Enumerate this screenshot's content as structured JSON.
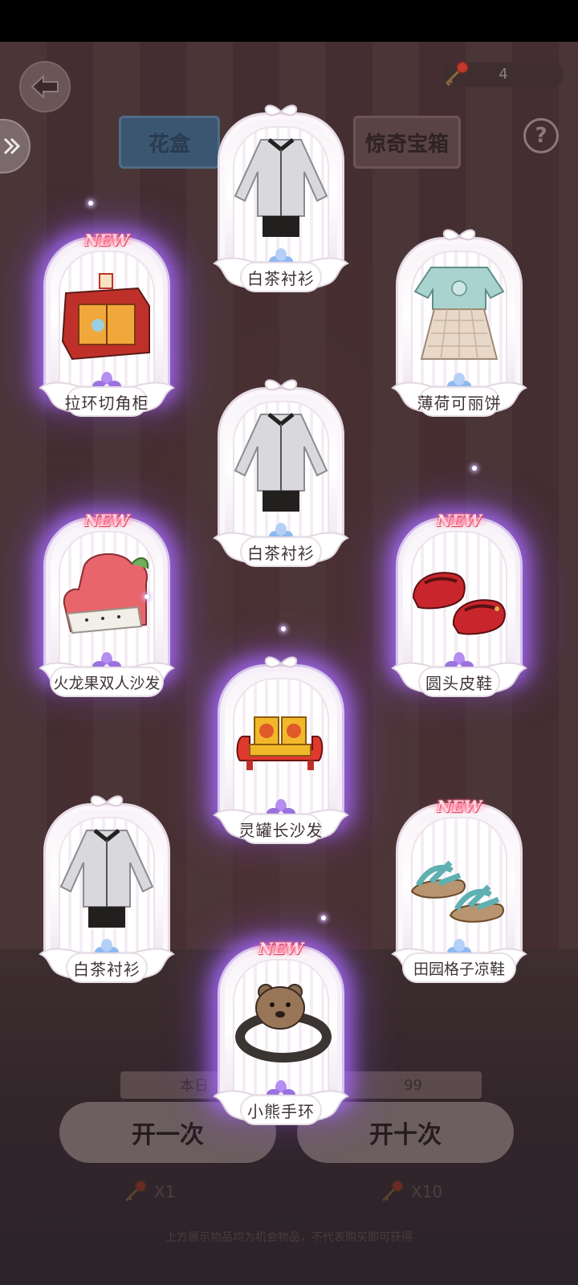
{
  "header": {
    "key_count": "4",
    "tabs": {
      "flower_box": "花盒",
      "surprise_chest": "惊奇宝箱"
    },
    "help_label": "?"
  },
  "footer": {
    "daily_prefix": "本日",
    "daily_suffix": "99",
    "open_once_label": "开一次",
    "open_ten_label": "开十次",
    "cost_once": "X1",
    "cost_ten": "X10",
    "disclaimer": "上方展示物品均为机会物品，不代表购买即可获得"
  },
  "new_label": "NEW",
  "cards": [
    {
      "name": "白茶衬衫",
      "rarity": "normal",
      "new": false,
      "icon": "shirt-white-tea"
    },
    {
      "name": "拉环切角柜",
      "rarity": "rare",
      "new": true,
      "icon": "cabinet-pulltab"
    },
    {
      "name": "薄荷可丽饼",
      "rarity": "normal",
      "new": false,
      "icon": "outfit-mint-crepe"
    },
    {
      "name": "白茶衬衫",
      "rarity": "normal",
      "new": false,
      "icon": "shirt-white-tea"
    },
    {
      "name": "火龙果双人沙发",
      "rarity": "rare",
      "new": true,
      "icon": "sofa-dragonfruit"
    },
    {
      "name": "圆头皮鞋",
      "rarity": "rare",
      "new": true,
      "icon": "shoes-round-toe"
    },
    {
      "name": "灵罐长沙发",
      "rarity": "rare",
      "new": false,
      "icon": "sofa-can"
    },
    {
      "name": "白茶衬衫",
      "rarity": "normal",
      "new": false,
      "icon": "shirt-white-tea"
    },
    {
      "name": "田园格子凉鞋",
      "rarity": "normal",
      "new": true,
      "icon": "sandals-plaid"
    },
    {
      "name": "小熊手环",
      "rarity": "rare",
      "new": true,
      "icon": "bracelet-bear"
    }
  ],
  "colors": {
    "rare_glow": "#a86eff",
    "normal_gem": "#8fb8f0",
    "rare_gem": "#b48ef0",
    "new_tag": "#ff5a7a"
  }
}
